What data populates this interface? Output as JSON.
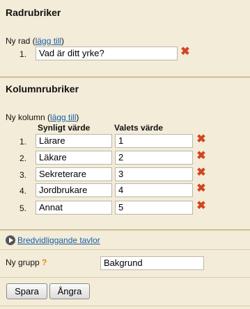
{
  "rows_section": {
    "title": "Radrubriker",
    "new_row_label": "Ny rad",
    "add_link": "lägg till",
    "rows": [
      {
        "num": "1.",
        "value": "Vad är ditt yrke?"
      }
    ]
  },
  "columns_section": {
    "title": "Kolumnrubriker",
    "new_column_label": "Ny kolumn",
    "add_link": "lägg till",
    "header_visible": "Synligt värde",
    "header_value": "Valets värde",
    "columns": [
      {
        "num": "1.",
        "visible": "Lärare",
        "value": "1"
      },
      {
        "num": "2.",
        "visible": "Läkare",
        "value": "2"
      },
      {
        "num": "3.",
        "visible": "Sekreterare",
        "value": "3"
      },
      {
        "num": "4.",
        "visible": "Jordbrukare",
        "value": "4"
      },
      {
        "num": "5.",
        "visible": "Annat",
        "value": "5"
      }
    ]
  },
  "wide_tables_link": "Bredvidliggande tavlor",
  "group": {
    "label": "Ny grupp",
    "help": "?",
    "value": "Bakgrund"
  },
  "buttons": {
    "save": "Spara",
    "undo": "Ångra"
  },
  "icons": {
    "delete": "delete-x-icon",
    "expand": "arrow-right-circle-icon"
  },
  "colors": {
    "background": "#f3ecd8",
    "delete": "#d2451f",
    "link": "#1a5ea8",
    "help": "#e88a12"
  }
}
